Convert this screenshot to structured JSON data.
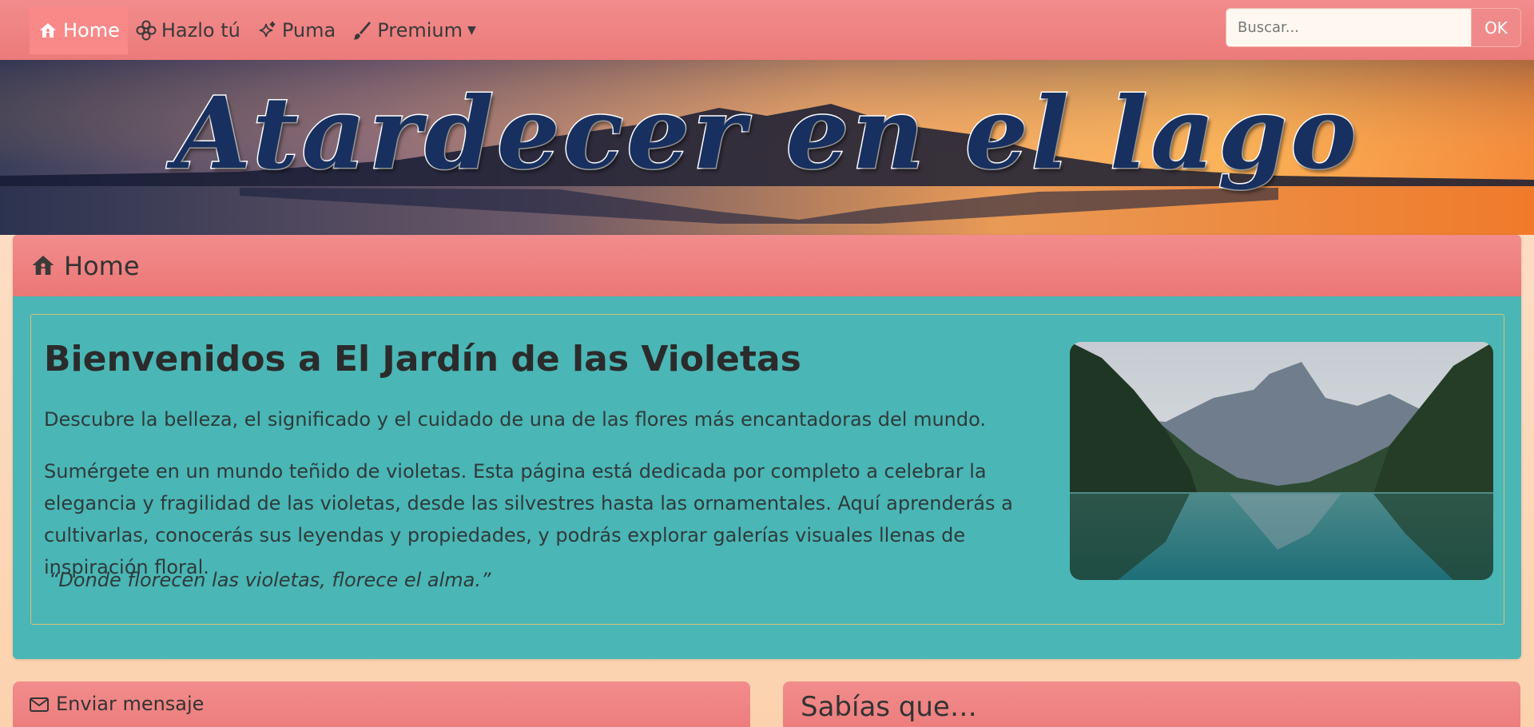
{
  "nav": {
    "items": [
      {
        "label": "Home",
        "icon": "house-icon",
        "active": true
      },
      {
        "label": "Hazlo tú",
        "icon": "flower-icon",
        "active": false
      },
      {
        "label": "Puma",
        "icon": "sparkles-icon",
        "active": false
      },
      {
        "label": "Premium",
        "icon": "brush-icon",
        "active": false,
        "dropdown": true
      }
    ],
    "search_placeholder": "Buscar...",
    "search_button": "OK"
  },
  "banner": {
    "title": "Atardecer en el lago"
  },
  "home_card": {
    "header": "Home",
    "title": "Bienvenidos a El Jardín de las Violetas",
    "paragraph1": "Descubre la belleza, el significado y el cuidado de una de las flores más encantadoras del mundo.",
    "paragraph2": "Sumérgete en un mundo teñido de violetas. Esta página está dedicada por completo a celebrar la elegancia y fragilidad de las violetas, desde las silvestres hasta las ornamentales. Aquí aprenderás a cultivarlas, conocerás sus leyendas y propiedades, y podrás explorar galerías visuales llenas de inspiración floral.",
    "quote": "“Donde florecen las violetas, florece el alma.”"
  },
  "message_card": {
    "header": "Enviar mensaje"
  },
  "facts_card": {
    "header": "Sabías que…"
  },
  "colors": {
    "navbar": "#ef8383",
    "card_body": "#4ab6b5",
    "page_bg": "#fcd9bf",
    "banner_title": "#17305f"
  }
}
